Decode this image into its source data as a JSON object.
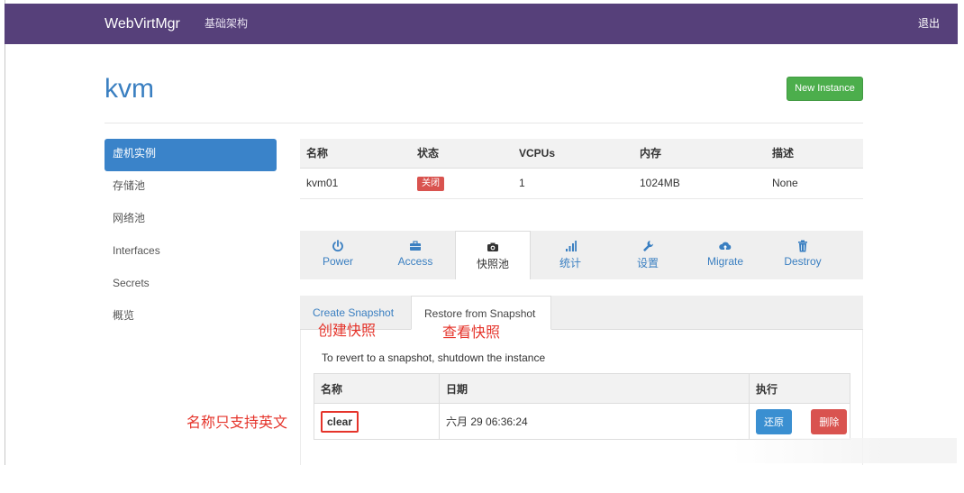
{
  "navbar": {
    "brand": "WebVirtMgr",
    "link": "基础架构",
    "logout": "退出"
  },
  "page": {
    "title": "kvm",
    "new_instance": "New Instance"
  },
  "sidebar": {
    "items": [
      {
        "label": "虚机实例",
        "active": true
      },
      {
        "label": "存储池"
      },
      {
        "label": "网络池"
      },
      {
        "label": "Interfaces"
      },
      {
        "label": "Secrets"
      },
      {
        "label": "概览"
      }
    ]
  },
  "instance_table": {
    "headers": [
      "名称",
      "状态",
      "VCPUs",
      "内存",
      "描述"
    ],
    "row": {
      "name": "kvm01",
      "status": "关闭",
      "vcpus": "1",
      "memory": "1024MB",
      "desc": "None"
    }
  },
  "tabs": [
    {
      "label": "Power",
      "icon": "power-icon"
    },
    {
      "label": "Access",
      "icon": "briefcase-icon"
    },
    {
      "label": "快照池",
      "icon": "camera-icon",
      "active": true
    },
    {
      "label": "统计",
      "icon": "signal-icon"
    },
    {
      "label": "设置",
      "icon": "wrench-icon"
    },
    {
      "label": "Migrate",
      "icon": "cloud-upload-icon"
    },
    {
      "label": "Destroy",
      "icon": "trash-icon"
    }
  ],
  "subtabs": {
    "create": "Create Snapshot",
    "restore": "Restore from Snapshot"
  },
  "annotations": {
    "create": "创建快照",
    "view": "查看快照",
    "name_note": "名称只支持英文"
  },
  "snapshot": {
    "hint": "To revert to a snapshot, shutdown the instance",
    "headers": [
      "名称",
      "日期",
      "执行"
    ],
    "row": {
      "name": "clear",
      "date": "六月 29 06:36:24"
    },
    "restore_label": "还原",
    "delete_label": "删除"
  },
  "colors": {
    "navbar": "#56407a",
    "accent": "#3a7fc1",
    "success": "#4cae4c",
    "danger": "#d9534f",
    "annotation": "#e5342b"
  }
}
